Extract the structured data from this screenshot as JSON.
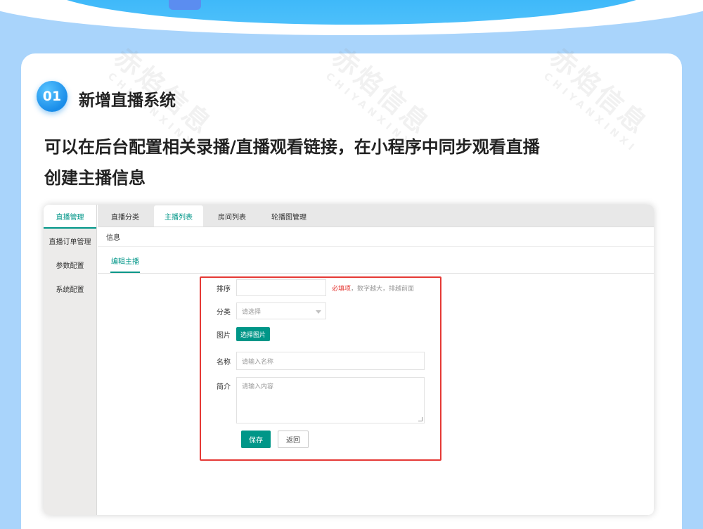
{
  "step": {
    "number": "01",
    "title": "新增直播系统"
  },
  "description": {
    "line1": "可以在后台配置相关录播/直播观看链接，在小程序中同步观看直播",
    "line2": "创建主播信息"
  },
  "watermark": {
    "main": "赤焰信息",
    "sub": "CHIYANXINXI"
  },
  "admin": {
    "sidebar": [
      {
        "label": "直播管理",
        "active": true
      },
      {
        "label": "直播订单管理",
        "active": false
      },
      {
        "label": "参数配置",
        "active": false
      },
      {
        "label": "系统配置",
        "active": false
      }
    ],
    "tabs": [
      {
        "label": "直播分类",
        "active": false
      },
      {
        "label": "主播列表",
        "active": true
      },
      {
        "label": "房间列表",
        "active": false
      },
      {
        "label": "轮播图管理",
        "active": false
      }
    ],
    "info_label": "信息",
    "sub_tab": "编辑主播",
    "form": {
      "sort_label": "排序",
      "sort_value": "",
      "sort_hint_required": "必填项",
      "sort_hint_text": "，数字越大，排越前面",
      "category_label": "分类",
      "category_placeholder": "请选择",
      "image_label": "图片",
      "image_button": "选择图片",
      "name_label": "名称",
      "name_placeholder": "请输入名称",
      "intro_label": "简介",
      "intro_placeholder": "请输入内容",
      "save_button": "保存",
      "back_button": "返回"
    }
  },
  "colors": {
    "page_bg": "#a9d4fb",
    "badge": "#1a8de9",
    "accent_green": "#009688",
    "highlight_red": "#e53935"
  }
}
